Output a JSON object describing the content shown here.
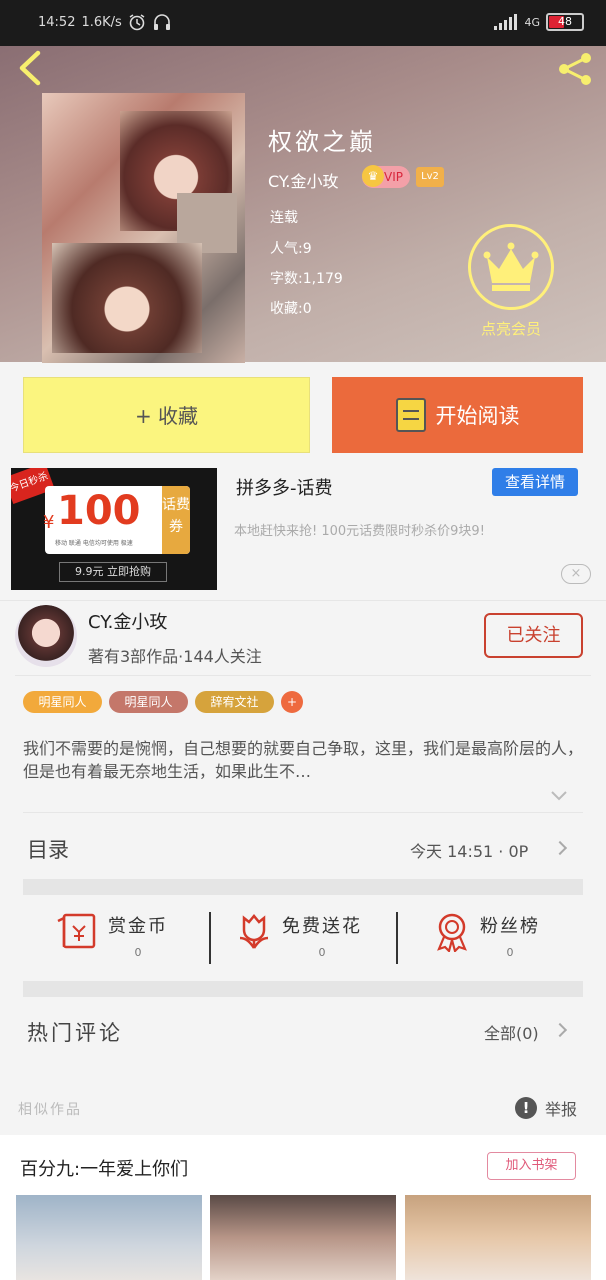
{
  "status_bar": {
    "time": "14:52",
    "speed": "1.6K/s",
    "network": "4G",
    "battery": "48"
  },
  "book": {
    "title": "权欲之巅",
    "author": "CY.金小玫",
    "vip": "VIP",
    "level": "Lv2",
    "status": "连载",
    "popularity": "人气:9",
    "word_count": "字数:1,179",
    "favorites": "收藏:0",
    "member_label": "点亮会员"
  },
  "actions": {
    "favorite": "+ 收藏",
    "read": "开始阅读"
  },
  "ad": {
    "flag": "今日秒杀",
    "coupon_amount": "100",
    "coupon_currency": "¥",
    "coupon_side": "话费券",
    "coupon_fine": "移动 联通 电信均可使用 极速",
    "buy_button": "9.9元 立即抢购",
    "title": "拼多多-话费",
    "detail_button": "查看详情",
    "description": "本地赶快来抢! 100元话费限时秒杀价9块9!",
    "close": "×"
  },
  "author_card": {
    "name": "CY.金小玫",
    "stats": "著有3部作品·144人关注",
    "follow": "已关注"
  },
  "tags": [
    {
      "label": "明星同人",
      "color": "#f2a93b"
    },
    {
      "label": "明星同人",
      "color": "#c4776a"
    },
    {
      "label": "辞宥文社",
      "color": "#d6a33c"
    },
    {
      "label": "+",
      "color": "#ee6a3f"
    }
  ],
  "description": "我们不需要的是惋惘，自己想要的就要自己争取，这里，我们是最高阶层的人，但是也有着最无奈地生活，如果此生不…",
  "catalog": {
    "label": "目录",
    "updated": "今天 14:51 · 0P"
  },
  "quick_actions": [
    {
      "label": "赏金币",
      "value": "0"
    },
    {
      "label": "免费送花",
      "value": "0"
    },
    {
      "label": "粉丝榜",
      "value": "0"
    }
  ],
  "comments": {
    "label": "热门评论",
    "all": "全部(0)"
  },
  "similar": {
    "label": "相似作品",
    "report": "举报"
  },
  "recommend": {
    "title": "百分九:一年爱上你们",
    "add_shelf": "加入书架"
  }
}
